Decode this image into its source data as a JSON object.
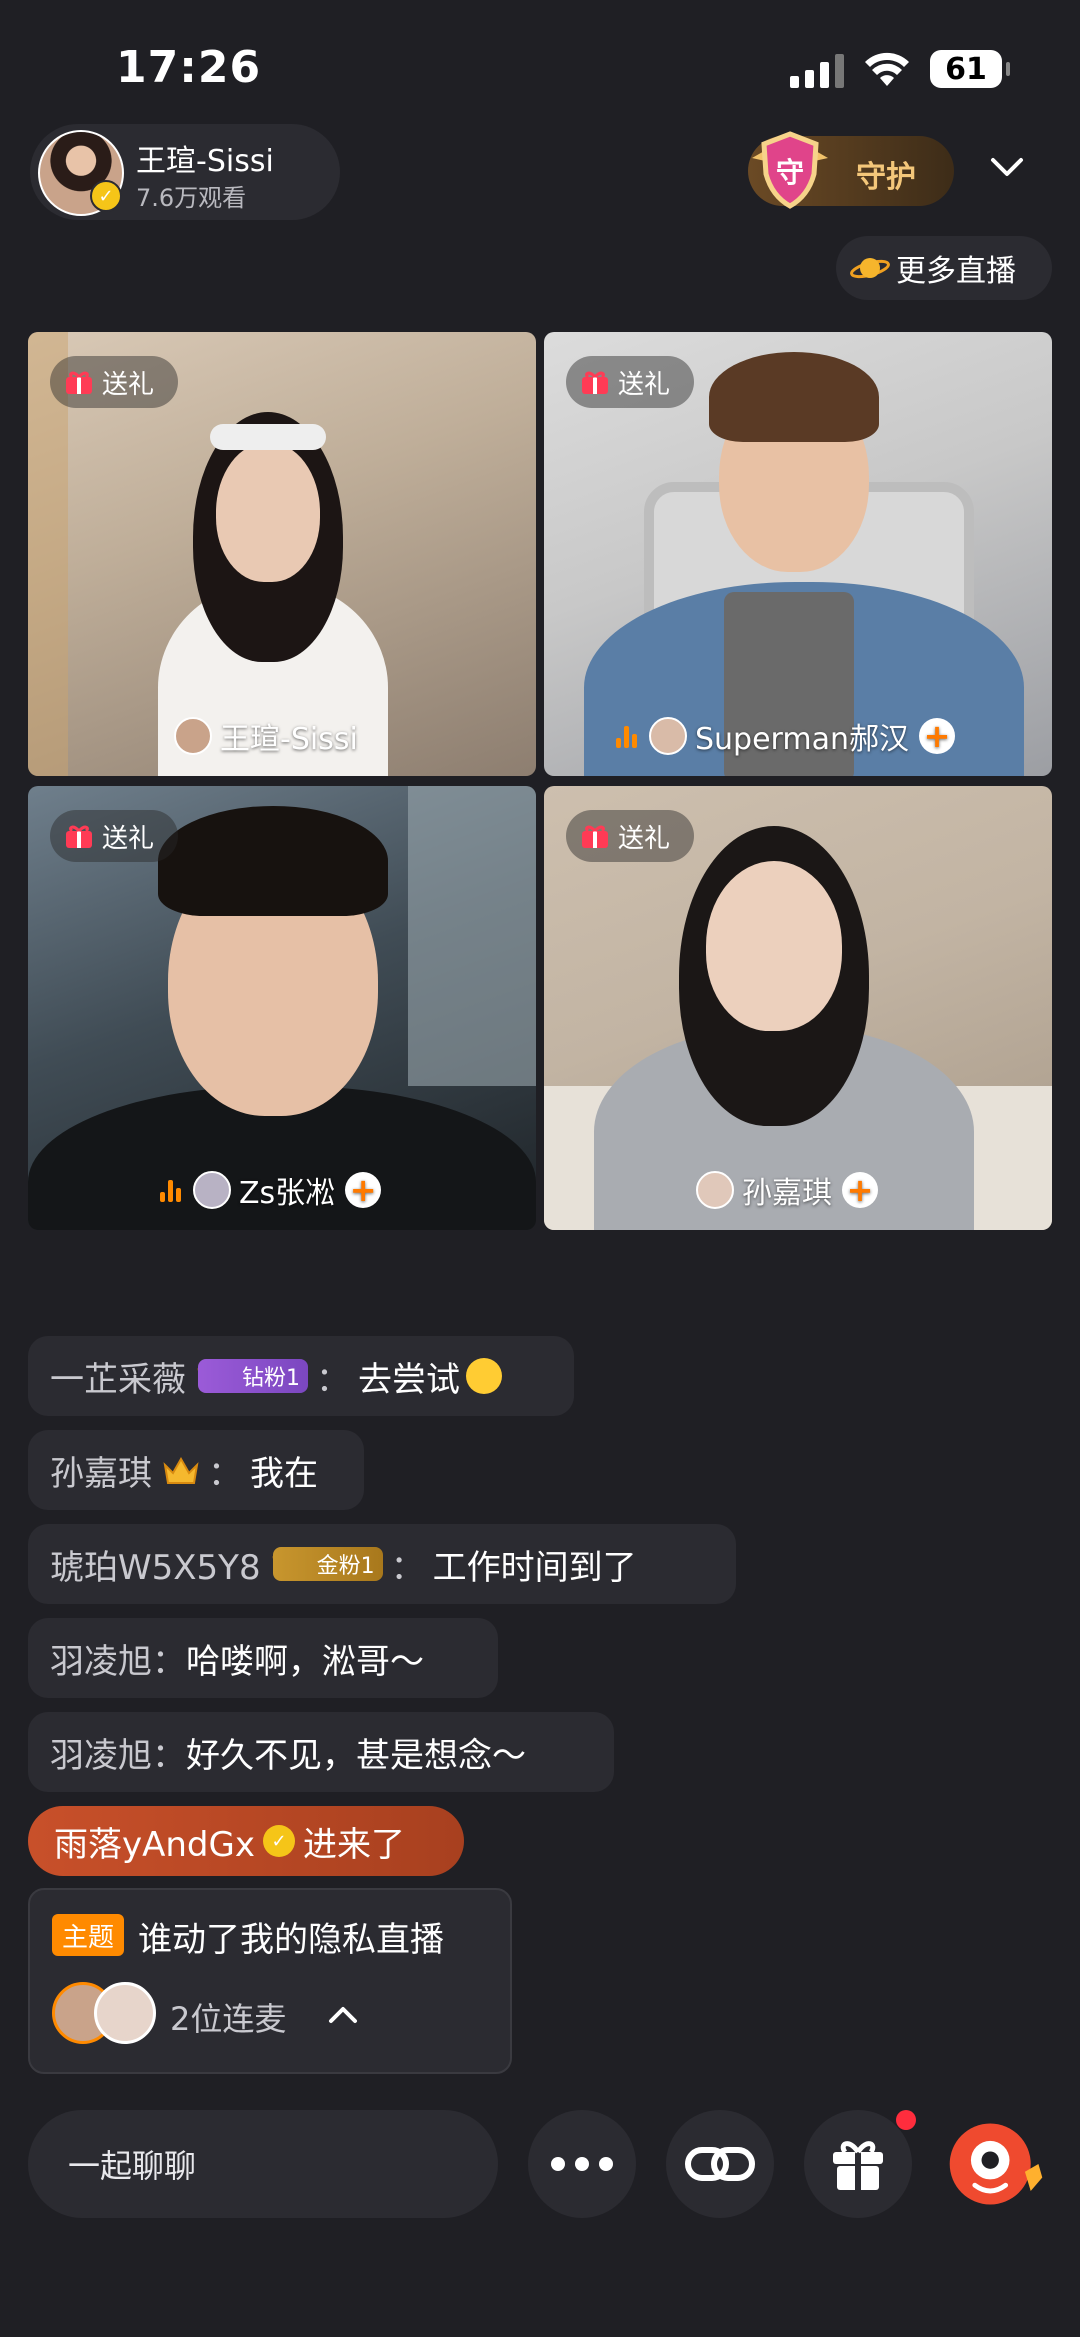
{
  "status_bar": {
    "time": "17:26",
    "battery": "61"
  },
  "host": {
    "name": "王瑄-Sissi",
    "views": "7.6万观看"
  },
  "guard_button": {
    "label": "守护",
    "shield_char": "守"
  },
  "more_live": {
    "label": "更多直播"
  },
  "tiles": [
    {
      "gift_label": "送礼",
      "name": "王瑄-Sissi"
    },
    {
      "gift_label": "送礼",
      "name": "Superman郝汉"
    },
    {
      "gift_label": "送礼",
      "name": "Zs张凇"
    },
    {
      "gift_label": "送礼",
      "name": "孙嘉琪"
    }
  ],
  "chat": [
    {
      "user": "一芷采薇",
      "badge": "钻粉1",
      "sep": "：",
      "message": "去尝试"
    },
    {
      "user": "孙嘉琪",
      "sep": "：",
      "message": "我在"
    },
    {
      "user": "琥珀W5X5Y8",
      "badge": "金粉1",
      "sep": "：",
      "message": "工作时间到了"
    },
    {
      "user": "羽凌旭：",
      "message": "哈喽啊，淞哥～"
    },
    {
      "user": "羽凌旭：",
      "message": "好久不见，甚是想念～"
    }
  ],
  "enter_notice": {
    "user": "雨落yAndGx",
    "suffix": "进来了"
  },
  "topic": {
    "tag": "主题",
    "title": "谁动了我的隐私直播",
    "count": "2位连麦"
  },
  "bottom": {
    "chat_placeholder": "一起聊聊"
  },
  "colors": {
    "accent": "#ff8a00",
    "background": "#1f1f24",
    "pill": "#2b2b31"
  }
}
